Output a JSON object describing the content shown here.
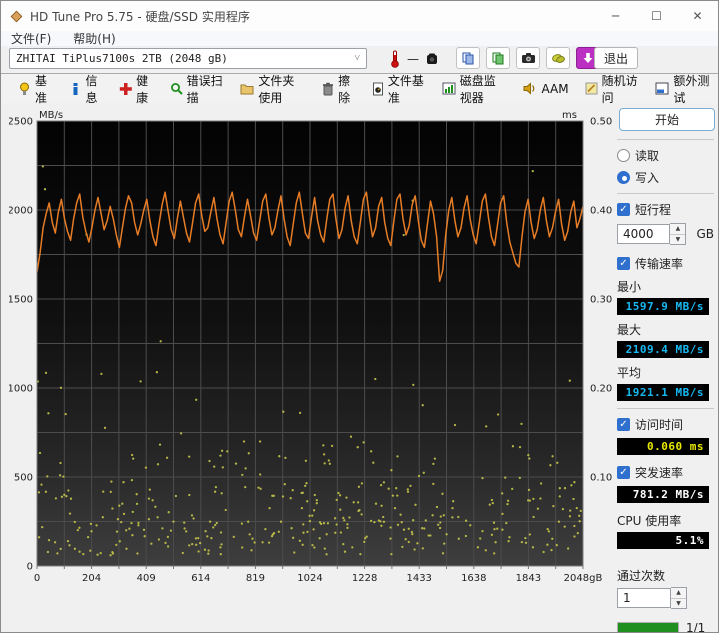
{
  "window": {
    "title": "HD Tune Pro 5.75 - 硬盘/SSD 实用程序"
  },
  "menu": {
    "file": "文件(F)",
    "help": "帮助(H)"
  },
  "toolbar": {
    "drive_selector": "ZHITAI TiPlus7100s 2TB (2048 gB)",
    "temperature": "—",
    "exit_label": "退出"
  },
  "tabs": [
    {
      "name": "benchmark",
      "icon": "bulb",
      "label": "基准"
    },
    {
      "name": "info",
      "icon": "info",
      "label": "信息"
    },
    {
      "name": "health",
      "icon": "health",
      "label": "健康"
    },
    {
      "name": "error-scan",
      "icon": "scan",
      "label": "错误扫描"
    },
    {
      "name": "folder-usage",
      "icon": "folder",
      "label": "文件夹使用"
    },
    {
      "name": "erase",
      "icon": "trash",
      "label": "擦除"
    },
    {
      "name": "file-benchmark",
      "icon": "filebench",
      "label": "文件基准"
    },
    {
      "name": "disk-monitor",
      "icon": "monitor",
      "label": "磁盘监视器"
    },
    {
      "name": "aam",
      "icon": "speaker",
      "label": "AAM"
    },
    {
      "name": "random-access",
      "icon": "random",
      "label": "随机访问"
    },
    {
      "name": "extra-tests",
      "icon": "extra",
      "label": "额外测试"
    }
  ],
  "chart_data": {
    "type": "line",
    "title": "",
    "left_axis": {
      "label": "MB/s",
      "min": 0,
      "max": 2500,
      "ticks": [
        2500,
        2000,
        1500,
        1000,
        500,
        0
      ]
    },
    "right_axis": {
      "label": "ms",
      "min": 0,
      "max": 0.5,
      "ticks": [
        0.5,
        0.4,
        0.3,
        0.2,
        0.1
      ]
    },
    "x_axis": {
      "min": 0,
      "max": 2048,
      "tick_labels": [
        "0",
        "204",
        "409",
        "614",
        "819",
        "1024",
        "1228",
        "1433",
        "1638",
        "1843",
        "2048gB"
      ]
    },
    "grid": {
      "v_divisions": 20,
      "h_divisions": 10
    },
    "series": [
      {
        "name": "transfer-rate",
        "color": "#e67d26",
        "values": [
          1650,
          1760,
          1900,
          1980,
          2040,
          1930,
          1870,
          1990,
          2060,
          1950,
          1880,
          1830,
          1950,
          2040,
          2090,
          1960,
          1880,
          1820,
          1900,
          2000,
          2070,
          1980,
          1890,
          1940,
          2020,
          1950,
          1860,
          1790,
          1900,
          2010,
          2080,
          2040,
          1930,
          1860,
          1920,
          2000,
          2060,
          1940,
          1850,
          1800,
          1920,
          2030,
          2100,
          1990,
          1890,
          1840,
          1950,
          2050,
          1960,
          1870,
          1820,
          1930,
          2040,
          2090,
          1970,
          1880,
          1900,
          1990,
          2070,
          1950,
          1860,
          1810,
          1930,
          2050,
          2100,
          2000,
          1890,
          1850,
          1960,
          2060,
          1970,
          1870,
          1830,
          1940,
          2050,
          2090,
          1960,
          1860,
          1900,
          2000,
          2080,
          1950,
          1850,
          1800,
          1920,
          2040,
          2100,
          1980,
          1870,
          1840,
          1960,
          2070,
          1940,
          1860,
          1820,
          1950,
          2060,
          2090,
          1950,
          1840,
          1890,
          2010,
          2080,
          1940,
          1850,
          1810,
          1930,
          2060,
          2100,
          1960,
          1850,
          1900,
          2020,
          2070,
          1930,
          1840,
          1800,
          1940,
          2060,
          2090,
          1950,
          1860,
          1910,
          2030,
          2080,
          1940,
          1830,
          1790,
          1920,
          2050,
          1980,
          1850,
          1600,
          1660,
          1860,
          2000,
          2070,
          1940,
          1850,
          1900,
          2010,
          2080,
          1950,
          1860,
          1810,
          1930,
          2050,
          2090,
          1960,
          1850,
          1800,
          1920,
          2040,
          2080,
          1930,
          1820,
          1760,
          1700,
          1680,
          1850,
          1990,
          2060,
          1930,
          1840,
          1890,
          2000,
          2070,
          1940,
          1850,
          1900,
          1990,
          2060,
          1920,
          1830,
          1880,
          1990,
          2050,
          1900,
          1950,
          2020
        ]
      }
    ],
    "scatter": {
      "name": "access-time",
      "color": "#c2c24a",
      "seed": 42,
      "bands": [
        {
          "ms_min": 0.012,
          "ms_max": 0.055,
          "count": 200
        },
        {
          "ms_min": 0.055,
          "ms_max": 0.095,
          "count": 120
        },
        {
          "ms_min": 0.095,
          "ms_max": 0.14,
          "count": 55
        },
        {
          "ms_min": 0.14,
          "ms_max": 0.22,
          "count": 22
        },
        {
          "ms_min": 0.22,
          "ms_max": 0.46,
          "count": 7
        }
      ]
    }
  },
  "sidebar": {
    "start_button": "开始",
    "mode": {
      "read_label": "读取",
      "write_label": "写入",
      "selected": "write"
    },
    "short_stroke": {
      "label": "短行程",
      "checked": true,
      "value": "4000",
      "unit": "GB"
    },
    "transfer_rate": {
      "label": "传输速率",
      "checked": true,
      "min_label": "最小",
      "min_value": "1597.9 MB/s",
      "max_label": "最大",
      "max_value": "2109.4 MB/s",
      "avg_label": "平均",
      "avg_value": "1921.1 MB/s"
    },
    "access_time": {
      "label": "访问时间",
      "checked": true,
      "value": "0.060 ms"
    },
    "burst_rate": {
      "label": "突发速率",
      "checked": true,
      "value": "781.2 MB/s"
    },
    "cpu_usage": {
      "label": "CPU 使用率",
      "value": "5.1%"
    },
    "pass_count": {
      "label": "通过次数",
      "value": "1",
      "progress_percent": 100,
      "progress_label": "1/1"
    }
  },
  "colors": {
    "speed_value": "#17b9f2",
    "time_value": "#e8e800",
    "white_value": "#ffffff",
    "line": "#e67d26",
    "scatter": "#c2c24a",
    "progress": "#1f8f1f"
  }
}
